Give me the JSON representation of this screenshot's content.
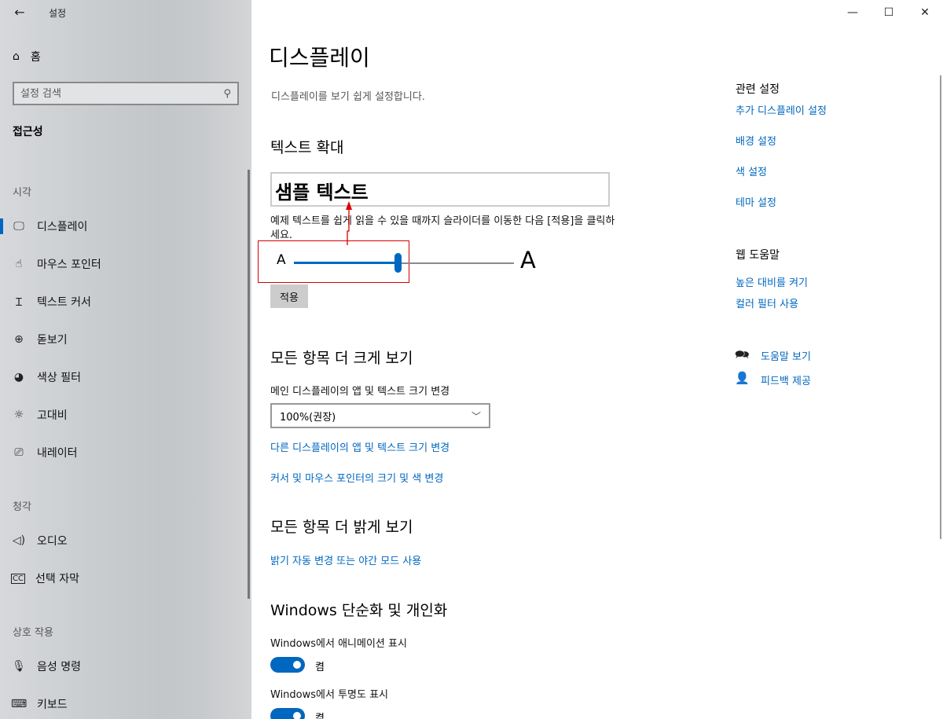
{
  "window": {
    "title": "설정",
    "back_icon": "←",
    "minimize_icon": "—",
    "maximize_icon": "☐",
    "close_icon": "✕"
  },
  "sidebar": {
    "home_label": "홈",
    "search_placeholder": "설정 검색",
    "section_title": "접근성",
    "groups": [
      {
        "label": "시각",
        "items": [
          {
            "label": "디스플레이",
            "icon": "monitor-icon",
            "active": true
          },
          {
            "label": "마우스 포인터",
            "icon": "mouse-pointer-icon"
          },
          {
            "label": "텍스트 커서",
            "icon": "text-cursor-icon"
          },
          {
            "label": "돋보기",
            "icon": "magnifier-icon"
          },
          {
            "label": "색상 필터",
            "icon": "palette-icon"
          },
          {
            "label": "고대비",
            "icon": "brightness-icon"
          },
          {
            "label": "내레이터",
            "icon": "narrator-icon"
          }
        ]
      },
      {
        "label": "청각",
        "items": [
          {
            "label": "오디오",
            "icon": "speaker-icon"
          },
          {
            "label": "선택 자막",
            "icon": "closed-caption-icon"
          }
        ]
      },
      {
        "label": "상호 작용",
        "items": [
          {
            "label": "음성 명령",
            "icon": "microphone-icon"
          },
          {
            "label": "키보드",
            "icon": "keyboard-icon"
          }
        ]
      }
    ]
  },
  "main": {
    "title": "디스플레이",
    "description": "디스플레이를 보기 쉽게 설정합니다.",
    "text_size": {
      "heading": "텍스트 확대",
      "sample": "샘플 텍스트",
      "instruction": "예제 텍스트를 쉽게 읽을 수 있을 때까지 슬라이더를 이동한 다음 [적용]을 클릭하세요.",
      "small_a": "A",
      "large_a": "A",
      "slider_value": 0.47,
      "apply_label": "적용"
    },
    "scale": {
      "heading": "모든 항목 더 크게 보기",
      "label": "메인 디스플레이의 앱 및 텍스트 크기 변경",
      "selected": "100%(권장)",
      "link1": "다른 디스플레이의 앱 및 텍스트 크기 변경",
      "link2": "커서 및 마우스 포인터의 크기 및 색 변경"
    },
    "brightness": {
      "heading": "모든 항목 더 밝게 보기",
      "link": "밝기 자동 변경 또는 야간 모드 사용"
    },
    "simplify": {
      "heading": "Windows 단순화 및 개인화",
      "animation_label": "Windows에서 애니메이션 표시",
      "animation_state": "켬",
      "transparency_label": "Windows에서 투명도 표시",
      "transparency_state": "켬"
    }
  },
  "right": {
    "related_heading": "관련 설정",
    "related_links": [
      "추가 디스플레이 설정",
      "배경 설정",
      "색 설정",
      "테마 설정"
    ],
    "web_help_heading": "웹 도움말",
    "web_links": [
      "높은 대비를 켜기",
      "컬러 필터 사용"
    ],
    "help_label": "도움말 보기",
    "feedback_label": "피드백 제공"
  },
  "colors": {
    "accent": "#0067c0",
    "highlight_box": "#d40000"
  }
}
